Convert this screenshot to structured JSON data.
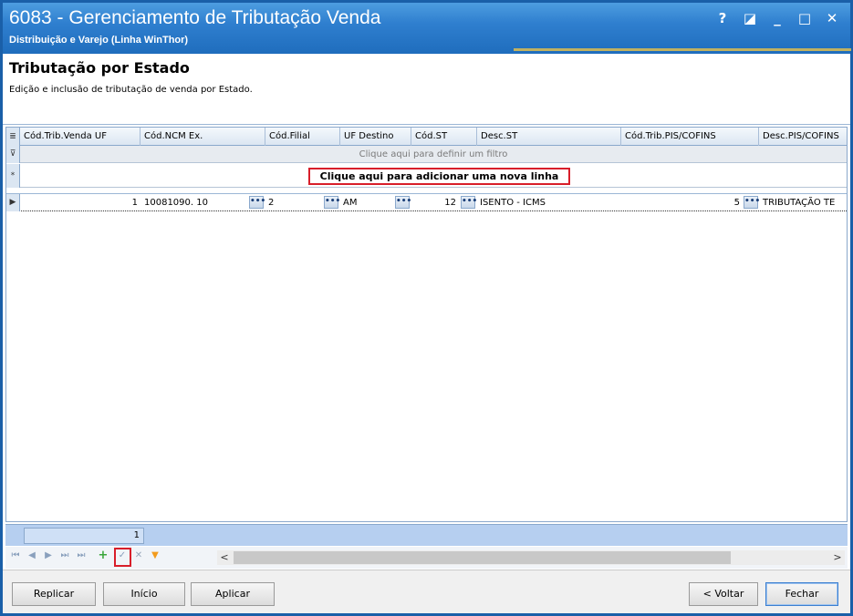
{
  "window": {
    "title": "6083 - Gerenciamento de Tributação Venda",
    "subtitle": "Distribuição e Varejo (Linha WinThor)",
    "controls": [
      "?",
      "◪",
      "_",
      "□",
      "✕"
    ]
  },
  "header": {
    "title": "Tributação por Estado",
    "description": "Edição e inclusão de tributação de venda por Estado."
  },
  "grid": {
    "columns": [
      "Cód.Trib.Venda UF",
      "Cód.NCM Ex.",
      "Cód.Filial",
      "UF Destino",
      "Cód.ST",
      "Desc.ST",
      "Cód.Trib.PIS/COFINS",
      "Desc.PIS/COFINS"
    ],
    "filter_text": "Clique aqui para definir um filtro",
    "new_row_text": "Clique aqui para adicionar uma nova linha",
    "rows": [
      {
        "cod_trib_venda_uf": "1",
        "cod_ncm_ex": "10081090. 10",
        "cod_filial": "2",
        "uf_destino": "AM",
        "cod_st": "12",
        "desc_st": "ISENTO - ICMS",
        "cod_trib_pis_cofins": "5",
        "desc_pis_cofins": "TRIBUTAÇÃO TE"
      }
    ],
    "ellipsis": "•••",
    "row_indicators": {
      "header": "≣",
      "filter": "⊽",
      "new": "*",
      "current": "▶"
    }
  },
  "summary": {
    "count": "1"
  },
  "navigator": {
    "first": "⏮",
    "prev_page": "◀",
    "next": "▶",
    "next_page": "⏭",
    "last": "⏭",
    "add": "+",
    "confirm": "✓",
    "cancel": "✕",
    "filter": "▼",
    "scroll_left": "<",
    "scroll_right": ">"
  },
  "buttons": {
    "replicar": "Replicar",
    "inicio": "Início",
    "aplicar": "Aplicar",
    "voltar": "< Voltar",
    "fechar": "Fechar"
  },
  "colors": {
    "titlebar": "#2f7fcf",
    "highlight": "#d81e2a",
    "summary": "#b6cff0"
  }
}
